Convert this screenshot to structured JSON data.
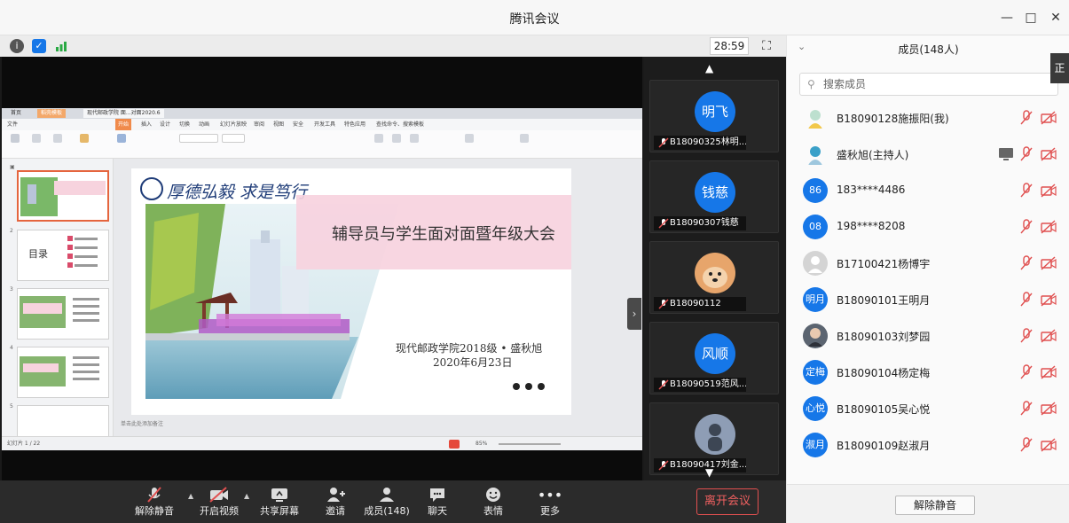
{
  "app": {
    "title": "腾讯会议"
  },
  "meeting": {
    "timer": "28:59"
  },
  "wps": {
    "tabs": [
      "首页",
      "稻壳模板",
      "现代邮政学院 面...对面2020.6"
    ],
    "menu": [
      "文件",
      "开始",
      "插入",
      "设计",
      "切换",
      "动画",
      "幻灯片放映",
      "审阅",
      "视图",
      "安全",
      "开发工具",
      "特色应用",
      "查找命令、搜索模板"
    ],
    "status_left": "幻灯片 1 / 22",
    "status_notes": "单击此处添加备注",
    "status_zoom": "85%"
  },
  "slide": {
    "calligraphy": "厚德弘毅 求是笃行",
    "title": "辅导员与学生面对面暨年级大会",
    "author": "现代邮政学院2018级 • 盛秋旭",
    "date": "2020年6月23日",
    "thumb2_title": "目录"
  },
  "video_tiles": [
    {
      "avatar": "明飞",
      "name": "B18090325林明..."
    },
    {
      "avatar": "钱慈",
      "name": "B18090307钱慈"
    },
    {
      "avatar": "",
      "name": "B18090112"
    },
    {
      "avatar": "风顺",
      "name": "B18090519范风..."
    },
    {
      "avatar": "",
      "name": "B18090417刘金..."
    }
  ],
  "toolbar": {
    "mute": "解除静音",
    "video": "开启视频",
    "share": "共享屏幕",
    "invite": "邀请",
    "members": "成员(148)",
    "chat": "聊天",
    "reactions": "表情",
    "more": "更多",
    "leave": "离开会议"
  },
  "panel": {
    "title": "成员(148人)",
    "search_placeholder": "搜索成员",
    "unmute_all": "解除静音",
    "members": [
      {
        "avatar": "",
        "name": "B18090128施振阳(我)"
      },
      {
        "avatar": "",
        "name": "盛秋旭(主持人)"
      },
      {
        "avatar": "86",
        "name": "183****4486"
      },
      {
        "avatar": "08",
        "name": "198****8208"
      },
      {
        "avatar": "",
        "name": "B17100421杨博宇"
      },
      {
        "avatar": "明月",
        "name": "B18090101王明月"
      },
      {
        "avatar": "",
        "name": "B18090103刘梦园"
      },
      {
        "avatar": "定梅",
        "name": "B18090104杨定梅"
      },
      {
        "avatar": "心悦",
        "name": "B18090105吴心悦"
      },
      {
        "avatar": "淑月",
        "name": "B18090109赵淑月"
      }
    ]
  },
  "edge_tag": "正",
  "icons": {
    "info": "info-icon",
    "shield": "shield-icon",
    "signal": "signal-icon",
    "fullscreen": "fullscreen-icon",
    "mic_off": "mic-off-icon",
    "camera_off": "camera-off-icon"
  },
  "colors": {
    "accent": "#1677e8",
    "mute_red": "#e05050",
    "leave_red": "#e25050"
  }
}
